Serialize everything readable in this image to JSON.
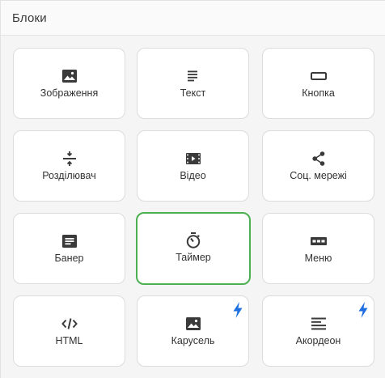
{
  "header": {
    "title": "Блоки"
  },
  "colors": {
    "icon": "#3a3a3a",
    "accent_selected": "#4caf50",
    "bolt": "#1f6fe0"
  },
  "tiles": [
    {
      "label": "Зображення",
      "icon": "image-icon"
    },
    {
      "label": "Текст",
      "icon": "text-lines-icon"
    },
    {
      "label": "Кнопка",
      "icon": "button-rectangle-icon"
    },
    {
      "label": "Розділювач",
      "icon": "divider-icon"
    },
    {
      "label": "Відео",
      "icon": "video-icon"
    },
    {
      "label": "Соц. мережі",
      "icon": "share-icon"
    },
    {
      "label": "Банер",
      "icon": "banner-icon"
    },
    {
      "label": "Таймер",
      "icon": "timer-icon",
      "selected": true
    },
    {
      "label": "Меню",
      "icon": "menu-icon"
    },
    {
      "label": "HTML",
      "icon": "code-icon"
    },
    {
      "label": "Карусель",
      "icon": "carousel-icon",
      "premium": true
    },
    {
      "label": "Акордеон",
      "icon": "accordion-icon",
      "premium": true
    }
  ]
}
